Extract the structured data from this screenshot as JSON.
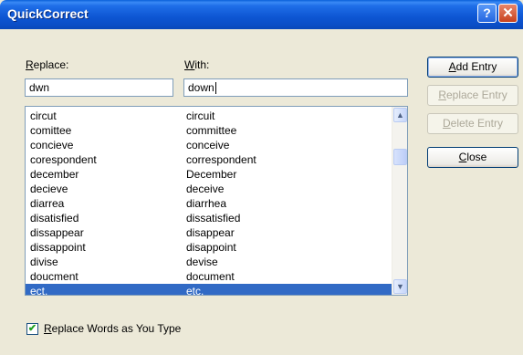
{
  "window": {
    "title": "QuickCorrect",
    "help_glyph": "?",
    "close_glyph": "✕"
  },
  "replace": {
    "label_key": "R",
    "label_rest": "eplace:",
    "value": "dwn"
  },
  "with": {
    "label_key": "W",
    "label_rest": "ith:",
    "value": "down"
  },
  "list": {
    "rows": [
      {
        "from": "circut",
        "to": "circuit"
      },
      {
        "from": "comittee",
        "to": "committee"
      },
      {
        "from": "concieve",
        "to": "conceive"
      },
      {
        "from": "corespondent",
        "to": "correspondent"
      },
      {
        "from": "december",
        "to": "December"
      },
      {
        "from": "decieve",
        "to": "deceive"
      },
      {
        "from": "diarrea",
        "to": "diarrhea"
      },
      {
        "from": "disatisfied",
        "to": "dissatisfied"
      },
      {
        "from": "dissappear",
        "to": "disappear"
      },
      {
        "from": "dissappoint",
        "to": "disappoint"
      },
      {
        "from": "divise",
        "to": "devise"
      },
      {
        "from": "doucment",
        "to": "document"
      },
      {
        "from": "ect.",
        "to": "etc."
      }
    ],
    "selected_index": 12
  },
  "buttons": {
    "add": {
      "key": "A",
      "rest": "dd Entry"
    },
    "replace": {
      "key": "R",
      "rest": "eplace Entry"
    },
    "delete": {
      "key": "D",
      "rest": "elete Entry"
    },
    "close": {
      "key": "C",
      "rest": "lose"
    }
  },
  "option": {
    "key": "R",
    "rest": "eplace Words as You Type",
    "checked": true
  }
}
